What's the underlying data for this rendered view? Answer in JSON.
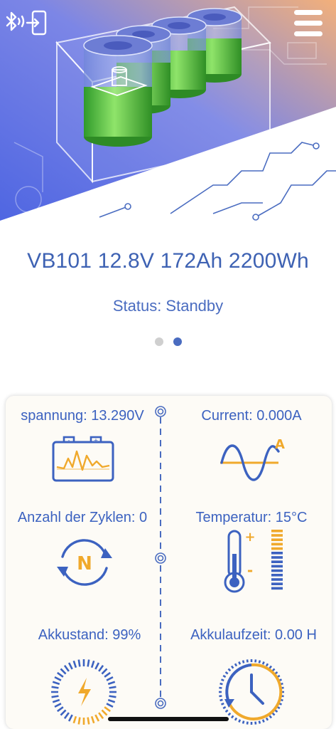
{
  "header": {
    "bluetooth_icon": "bluetooth-exit-icon",
    "menu_icon": "hamburger-menu-icon"
  },
  "device": {
    "title": "VB101 12.8V 172Ah 2200Wh",
    "status": "Status: Standby"
  },
  "pager": {
    "count": 2,
    "active": 2
  },
  "metrics": {
    "voltage_label": "spannung: 13.290V",
    "current_label": "Current: 0.000A",
    "cycles_label": "Anzahl der Zyklen: 0",
    "temperature_label": "Temperatur: 15°C",
    "soc_label": "Akkustand: 99%",
    "runtime_label": "Akkulaufzeit: 0.00 H"
  },
  "icon_text": {
    "current_letter": "A",
    "cycles_letter": "N",
    "thermo_plus": "+",
    "thermo_minus": "-",
    "battery_plus": "+",
    "battery_minus": "-"
  },
  "colors": {
    "accent_blue": "#3c62c0",
    "accent_orange": "#f0a92c",
    "hero_blue": "#5a6fe6",
    "hero_orange": "#f4b27a"
  }
}
